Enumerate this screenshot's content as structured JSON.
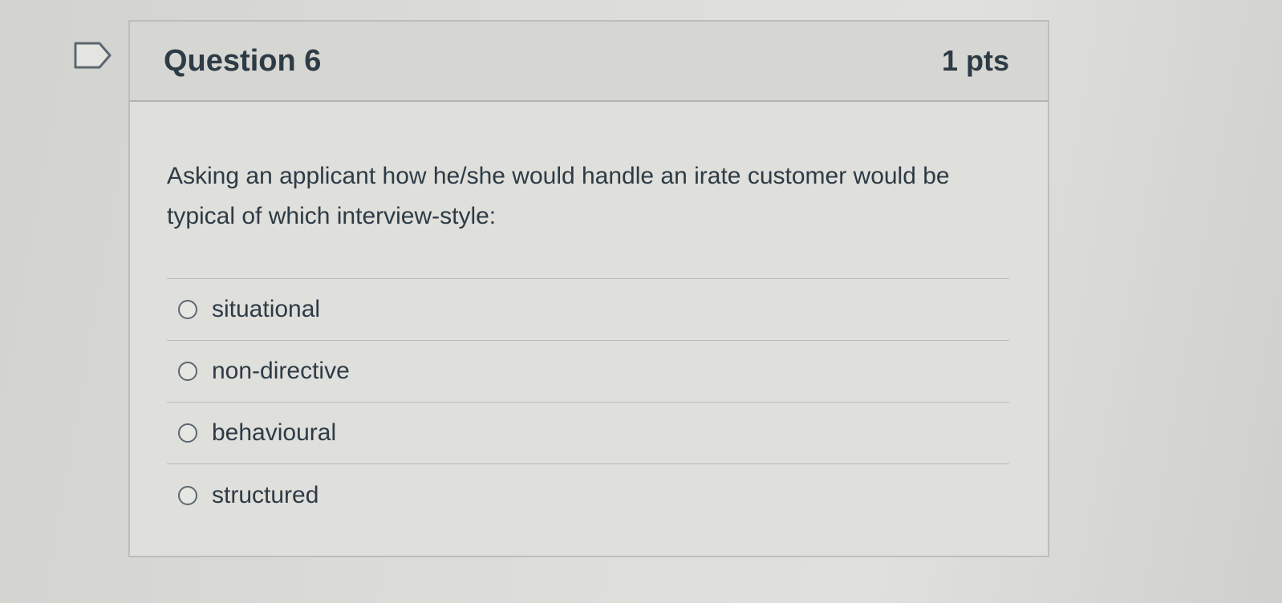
{
  "question": {
    "title": "Question 6",
    "points": "1 pts",
    "text": "Asking an applicant how he/she would handle an irate customer would be typical of which interview-style:",
    "flag_icon": "bookmark-flag-icon"
  },
  "answers": [
    {
      "label": "situational",
      "selected": false
    },
    {
      "label": "non-directive",
      "selected": false
    },
    {
      "label": "behavioural",
      "selected": false
    },
    {
      "label": "structured",
      "selected": false
    }
  ]
}
